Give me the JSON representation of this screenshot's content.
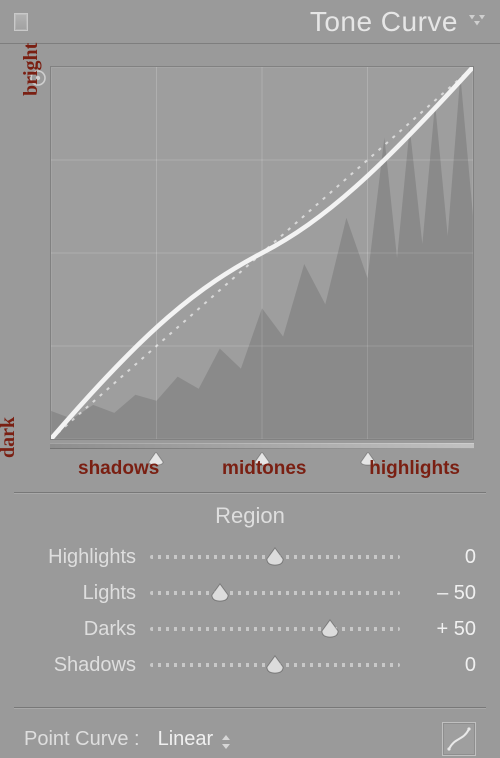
{
  "panel": {
    "title": "Tone Curve"
  },
  "curve": {
    "y_axis_top": "bright",
    "y_axis_bottom": "dark",
    "x_labels": [
      "shadows",
      "midtones",
      "highlights"
    ]
  },
  "region": {
    "title": "Region",
    "sliders": [
      {
        "label": "Highlights",
        "value": "0",
        "pos": 0.5
      },
      {
        "label": "Lights",
        "value": "– 50",
        "pos": 0.28
      },
      {
        "label": "Darks",
        "value": "+ 50",
        "pos": 0.72
      },
      {
        "label": "Shadows",
        "value": "0",
        "pos": 0.5
      }
    ]
  },
  "point_curve": {
    "label": "Point Curve :",
    "selected": "Linear"
  },
  "icons": {
    "collapse": "collapse-triangle",
    "target": "target-adjust",
    "edit": "curve-edit"
  },
  "range_splits": [
    0.25,
    0.5,
    0.75
  ]
}
